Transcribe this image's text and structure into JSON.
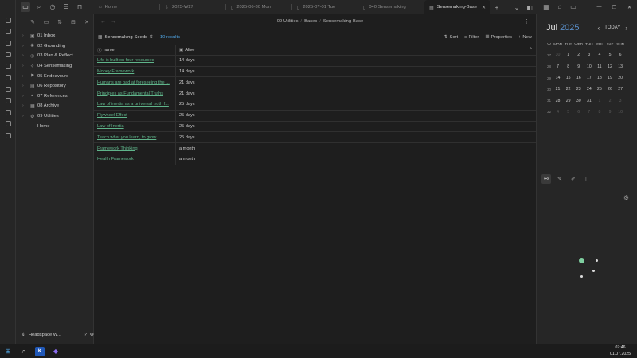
{
  "tabs": [
    {
      "label": "Home",
      "icon": "home-icon",
      "active": false
    },
    {
      "label": "2025-W27",
      "icon": "download-icon",
      "active": false
    },
    {
      "label": "2025-06-30 Mon",
      "icon": "file-icon",
      "active": false
    },
    {
      "label": "2025-07-01 Tue",
      "icon": "file-icon",
      "active": false
    },
    {
      "label": "040 Sensemaking",
      "icon": "file-icon",
      "active": false
    },
    {
      "label": "Sensemaking-Base",
      "icon": "table-icon",
      "active": true
    }
  ],
  "sidebar": {
    "items": [
      {
        "label": "01 Inbox",
        "icon": "inbox-icon"
      },
      {
        "label": "02 Grounding",
        "icon": "sun-icon"
      },
      {
        "label": "03 Plan & Reflect",
        "icon": "compass-icon"
      },
      {
        "label": "04 Sensemaking",
        "icon": "brain-icon"
      },
      {
        "label": "05 Endeavours",
        "icon": "flag-icon"
      },
      {
        "label": "06 Repository",
        "icon": "archive-icon"
      },
      {
        "label": "07 References",
        "icon": "link-icon"
      },
      {
        "label": "08 Archive",
        "icon": "box-icon"
      },
      {
        "label": "09 Utilities",
        "icon": "tool-icon"
      },
      {
        "label": "Home",
        "icon": "home-icon"
      }
    ],
    "workspace": "Headspace W..."
  },
  "breadcrumb": {
    "part1": "09 Utilities",
    "part2": "Bases",
    "part3": "Sensemaking-Base"
  },
  "base": {
    "view_name": "Sensemaking-Seeds",
    "results": "10 results",
    "sort": "Sort",
    "filter": "Filter",
    "properties": "Properties",
    "new": "New"
  },
  "table": {
    "col_name": "name",
    "col_alive": "Alive",
    "rows": [
      {
        "name": "Life is built on four resources",
        "alive": "14 days"
      },
      {
        "name": "Money Framework",
        "alive": "14 days"
      },
      {
        "name": "Humans are bad at foreseeing the ...",
        "alive": "21 days"
      },
      {
        "name": "Principles as Fundamental Truths",
        "alive": "21 days"
      },
      {
        "name": "Law of inertia as a universal truth f...",
        "alive": "25 days"
      },
      {
        "name": "Flywheel Effect",
        "alive": "25 days"
      },
      {
        "name": "Law of Inertia",
        "alive": "25 days"
      },
      {
        "name": "Teach what you learn, to grow",
        "alive": "25 days"
      },
      {
        "name": "Framework Thinking",
        "alive": "a month"
      },
      {
        "name": "Health Framework",
        "alive": "a month"
      }
    ]
  },
  "calendar": {
    "month": "Jul",
    "year": "2025",
    "today": "TODAY",
    "dow": [
      "W",
      "MON",
      "TUE",
      "WED",
      "THU",
      "FRI",
      "SAT",
      "SUN"
    ],
    "weeks": [
      [
        "27",
        "30",
        "1",
        "2",
        "3",
        "4",
        "5",
        "6"
      ],
      [
        "28",
        "7",
        "8",
        "9",
        "10",
        "11",
        "12",
        "13"
      ],
      [
        "29",
        "14",
        "15",
        "16",
        "17",
        "18",
        "19",
        "20"
      ],
      [
        "30",
        "21",
        "22",
        "23",
        "24",
        "25",
        "26",
        "27"
      ],
      [
        "31",
        "28",
        "29",
        "30",
        "31",
        "1",
        "2",
        "3"
      ],
      [
        "32",
        "4",
        "5",
        "6",
        "7",
        "8",
        "9",
        "10"
      ]
    ]
  },
  "taskbar": {
    "time": "07:46",
    "date": "01.07.2025"
  },
  "colors": {
    "accent": "#4fa3e0",
    "link": "#5fb48a",
    "graph_node": "#7fcfa0"
  }
}
